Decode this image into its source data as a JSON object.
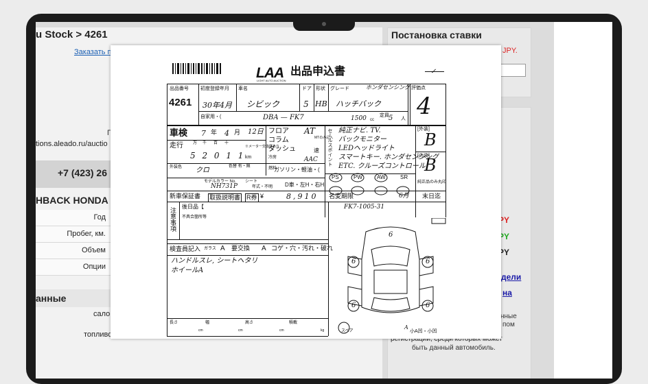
{
  "page": {
    "stock_title": "u Stock > 4261",
    "order_link": "Заказать п",
    "small_p": "П",
    "url": "tions.aleado.ru/auctio",
    "phone": "+7 (423) 26",
    "model_title": "HBACK HONDA S",
    "spec_labels": [
      "Год",
      "Пробег, км.",
      "Объем",
      "Опции"
    ],
    "section_title": "анные",
    "salon": "салон",
    "fuel": "топливо"
  },
  "right": {
    "bid_title": "Постановка ставки",
    "jpy_top": "JPY.",
    "py1": "PY",
    "py2": "PY",
    "py3": "PY",
    "link1": "дели",
    "link2": "на",
    "text1": "нные",
    "text2": "пом",
    "text3": "регистрации, среди которых может",
    "text4": "быть данный автомобиль."
  },
  "colors": {
    "red": "#dd2222",
    "green": "#22aa22",
    "link": "#1a1aa8"
  },
  "sheet": {
    "logo": "LAA",
    "logo_sub": "LIGHT AUTO AUCTION",
    "form_title": "出品申込書",
    "lot_label": "出品番号",
    "lot_number": "4261",
    "reg_label": "初度登録年月",
    "reg_value": "30年4月",
    "name_label": "車名",
    "car_name": "シビック",
    "door_label": "ドア",
    "door_value": "5",
    "shape_label": "形状",
    "shape_value": "HB",
    "grade_label": "グレード",
    "grade_value": "ハッチバック",
    "grade_note": "ホンダセンシング",
    "eval_label": "評価点",
    "eval_value": "4",
    "own_label": "自家用・(",
    "model_code": "DBA — FK7",
    "cc": "1500",
    "cc_unit": "cc",
    "capacity_label": "定員",
    "capacity": "5",
    "cap_unit": "人",
    "shaken_label": "車検",
    "shaken_year": "7",
    "shaken_year_unit": "年",
    "shaken_month": "4",
    "shaken_month_unit": "月",
    "shaken_day": "12日",
    "floor": "フロア",
    "column": "コラム",
    "dash": "ダッシュ",
    "at": "AT",
    "mt_label": "MTのみ記入",
    "speed": "速",
    "mileage_label": "走行",
    "mileage_units": [
      "万",
      "千",
      "百",
      "十"
    ],
    "mileage_value": "5 2 0 1 1",
    "km": "km",
    "mileage_note": "※メーター交換歴あり",
    "sales_point_label": "セールスポイント",
    "sales_points": [
      "純正ナビ. TV.",
      "バックモニター",
      "LEDヘッドライト",
      "スマートキー. ホンダセンシング",
      "ETC. クルーズコントロール"
    ],
    "ac_label": "冷房",
    "ac_value": "AAC",
    "fuel_label": "燃料",
    "fuel_value": "ガソリン・軽油・(",
    "ext_color_label": "外装色",
    "ext_color": "クロ",
    "color_change": "色替 有・無",
    "model_color_label": "モデルカラー No.",
    "color_code": "NH731P",
    "eq_labels": [
      "PS",
      "PW",
      "AW",
      "SR"
    ],
    "d_label": "D車・左H・右H",
    "year_label": "年式・不明",
    "sheet_label": "シート",
    "ext_grade_label": "[外装]",
    "ext_grade": "B",
    "int_grade_label": "[内装]",
    "int_grade": "B",
    "genuine_label": "純正品のみ丸印",
    "new_warranty": "新車保証書",
    "manual": "取扱説明書",
    "recycle_label": "R券",
    "recycle_yen": "¥",
    "recycle_value": "8,910",
    "meigi_label": "名変期限",
    "meigi_value": "6月",
    "meigi_end": "末日迄",
    "caution_label": "注意事項",
    "later_label": "後日品【",
    "defect_label": "不具合箇所等",
    "chassis": "FK7-1005-31",
    "inspector_label": "検査員記入",
    "glass_label": "ガラス",
    "glass_code": "A",
    "replace_label": "要交換",
    "seat_code": "A",
    "damage_label": "コゲ・穴・汚れ・破れ",
    "inspector_notes": [
      "ハンドルスレ, シートヘタリ",
      "ホイールA"
    ],
    "spare_label": "スペア",
    "bottom_labels": [
      "長さ",
      "幅",
      "高さ",
      "積載"
    ],
    "cm": "cm",
    "kg": "kg",
    "diagram_marks": [
      "6",
      "6",
      "6",
      "6",
      "6",
      "A",
      "A"
    ],
    "bottom_right": "小A凹・小凹"
  }
}
